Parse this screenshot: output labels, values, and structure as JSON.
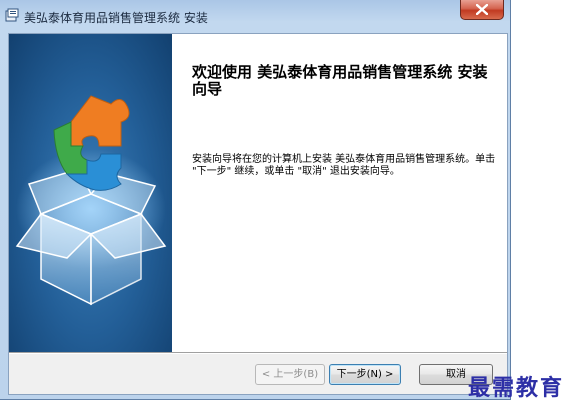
{
  "window": {
    "title": "美弘泰体育用品销售管理系统 安装"
  },
  "wizard": {
    "heading": "欢迎使用 美弘泰体育用品销售管理系统 安装向导",
    "body": "安装向导将在您的计算机上安装 美弘泰体育用品销售管理系统。单击 \"下一步\" 继续，或单击 \"取消\" 退出安装向导。"
  },
  "buttons": {
    "back": "< 上一步(B)",
    "next": "下一步(N) >",
    "cancel": "取消"
  },
  "watermark": "最需教育",
  "colors": {
    "accent_blue": "#235f98",
    "close_red": "#c13a21",
    "watermark": "#2d2fa6"
  },
  "icons": [
    "installer-icon",
    "close-icon",
    "puzzle-box-illustration"
  ]
}
